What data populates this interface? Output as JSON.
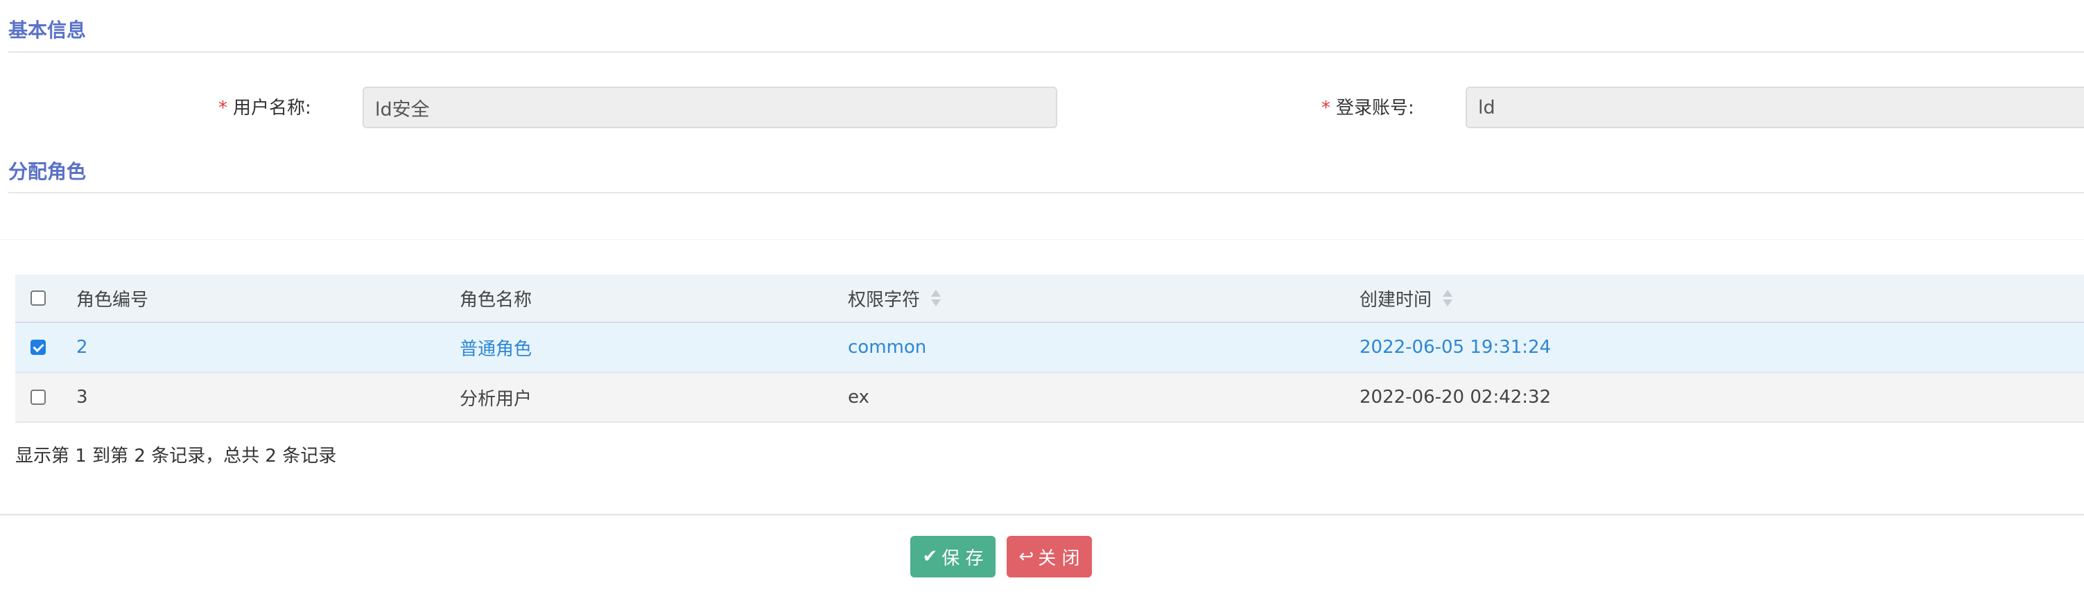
{
  "sections": {
    "basic_info": "基本信息",
    "assign_roles": "分配角色"
  },
  "form": {
    "user_name_label": "用户名称:",
    "user_name_value": "ld安全",
    "login_account_label": "登录账号:",
    "login_account_value": "ld",
    "required_mark": "*"
  },
  "table": {
    "columns": [
      "角色编号",
      "角色名称",
      "权限字符",
      "创建时间"
    ],
    "rows": [
      {
        "checked": true,
        "role_id": "2",
        "role_name": "普通角色",
        "permission": "common",
        "created": "2022-06-05 19:31:24"
      },
      {
        "checked": false,
        "role_id": "3",
        "role_name": "分析用户",
        "permission": "ex",
        "created": "2022-06-20 02:42:32"
      }
    ],
    "pagination_info": "显示第 1 到第 2 条记录，总共 2 条记录"
  },
  "buttons": {
    "save_label": "保 存",
    "close_label": "关 闭",
    "save_icon": "check-icon",
    "close_icon": "reply-icon"
  },
  "colors": {
    "section_title": "#5a72c7",
    "selected_text": "#2f86d4",
    "save_button": "#4caf8d",
    "close_button": "#e06167",
    "required": "#e23b3b"
  }
}
